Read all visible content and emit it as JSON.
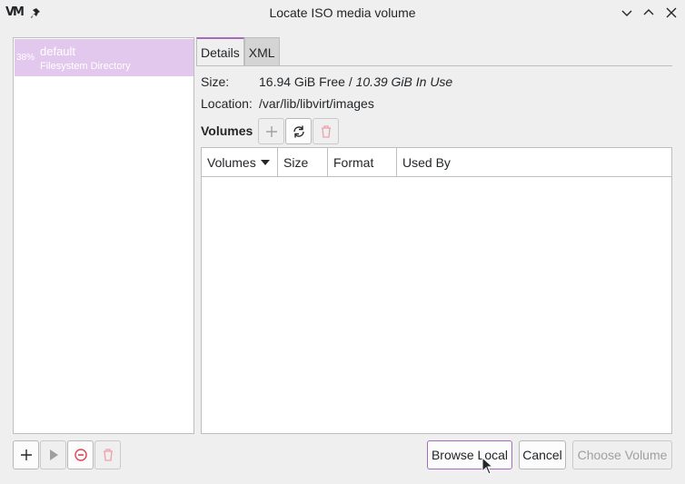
{
  "window": {
    "title": "Locate ISO media volume",
    "app_logo": "VM"
  },
  "pool_list": {
    "items": [
      {
        "usage": "38%",
        "name": "default",
        "type": "Filesystem Directory"
      }
    ]
  },
  "tabs": [
    {
      "label": "Details",
      "active": true
    },
    {
      "label": "XML",
      "active": false
    }
  ],
  "details": {
    "size_label": "Size:",
    "size_free": "16.94 GiB Free / ",
    "size_in_use": "10.39 GiB In Use",
    "location_label": "Location:",
    "location_value": "/var/lib/libvirt/images"
  },
  "volumes": {
    "title": "Volumes",
    "columns": [
      "Volumes",
      "Size",
      "Format",
      "Used By"
    ],
    "rows": []
  },
  "buttons": {
    "browse_local": "Browse Local",
    "cancel": "Cancel",
    "choose_volume": "Choose Volume"
  },
  "colors": {
    "accent": "#a46bbd",
    "selection": "#e2c8ed",
    "delete_red": "#da4453"
  }
}
